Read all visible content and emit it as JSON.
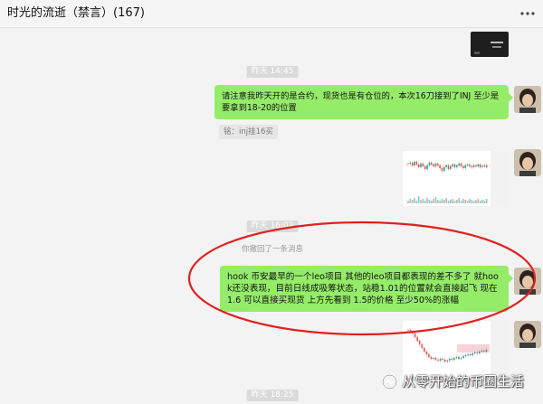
{
  "window": {
    "title": "时光的流逝（禁言）(167)"
  },
  "messages": {
    "ts1": "昨天 14:45",
    "msg1": "请注意我昨天开的是合约，现货也是有仓位的，本次16刀接到了INJ 至少是要拿到18-20的位置",
    "quote1": "铭：inj挂16买",
    "ts2": "昨天 16:02",
    "recall": "你撤回了一条消息",
    "msg2": "hook 币安最早的一个leo项目 其他的leo项目都表现的差不多了 就hook还没表现，目前日线成吸筹状态，站稳1.01的位置就会直接起飞  现在 1.6 可以直接买现货  上方先看到 1.5的价格  至少50%的涨幅",
    "ts3": "昨天 18:25"
  },
  "watermark": {
    "text": "从零开始的币圈生活"
  },
  "icons": {
    "more": "more-icon",
    "watermark": "wechat-channel-icon"
  },
  "colors": {
    "bubble": "#95ec69",
    "annotation": "#e02020",
    "background": "#f3f3f3"
  }
}
